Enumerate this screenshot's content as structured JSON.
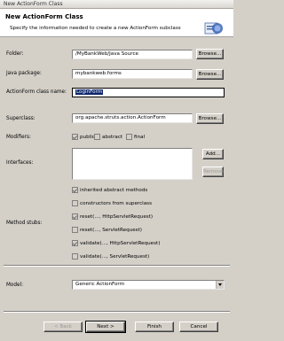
{
  "window": {
    "title": "New ActionForm Class"
  },
  "banner": {
    "title": "New ActionForm Class",
    "description": "Specify the information needed to create a new ActionForm subclass",
    "icon": "form-wizard-icon"
  },
  "form": {
    "folder": {
      "label": "Folder:",
      "value": "/MyBankWeb/Java Source",
      "browse": "Browse..."
    },
    "java_package": {
      "label": "Java package:",
      "value": "mybankweb.forms",
      "browse": "Browse..."
    },
    "class_name": {
      "label": "ActionForm class name:",
      "value": "LoginForm"
    },
    "superclass": {
      "label": "Superclass:",
      "value": "org.apache.struts.action.ActionForm",
      "browse": "Browse..."
    },
    "modifiers": {
      "label": "Modifiers:",
      "options": [
        {
          "label": "public",
          "checked": true
        },
        {
          "label": "abstract",
          "checked": false
        },
        {
          "label": "final",
          "checked": false
        }
      ]
    },
    "interfaces": {
      "label": "Interfaces:",
      "add": "Add...",
      "remove": "Remove"
    },
    "method_stubs": {
      "label": "Method stubs:",
      "options": [
        {
          "label": "inherited abstract methods",
          "checked": true
        },
        {
          "label": "constructors from superclass",
          "checked": false
        },
        {
          "label": "reset(..., HttpServletRequest)",
          "checked": true
        },
        {
          "label": "reset(..., ServletRequest)",
          "checked": false
        },
        {
          "label": "validate(..., HttpServletRequest)",
          "checked": true
        },
        {
          "label": "validate(..., ServletRequest)",
          "checked": false
        }
      ]
    },
    "model": {
      "label": "Model:",
      "value": "Generic ActionForm"
    }
  },
  "buttons": {
    "back": "< Back",
    "next": "Next >",
    "finish": "Finish",
    "cancel": "Cancel"
  }
}
